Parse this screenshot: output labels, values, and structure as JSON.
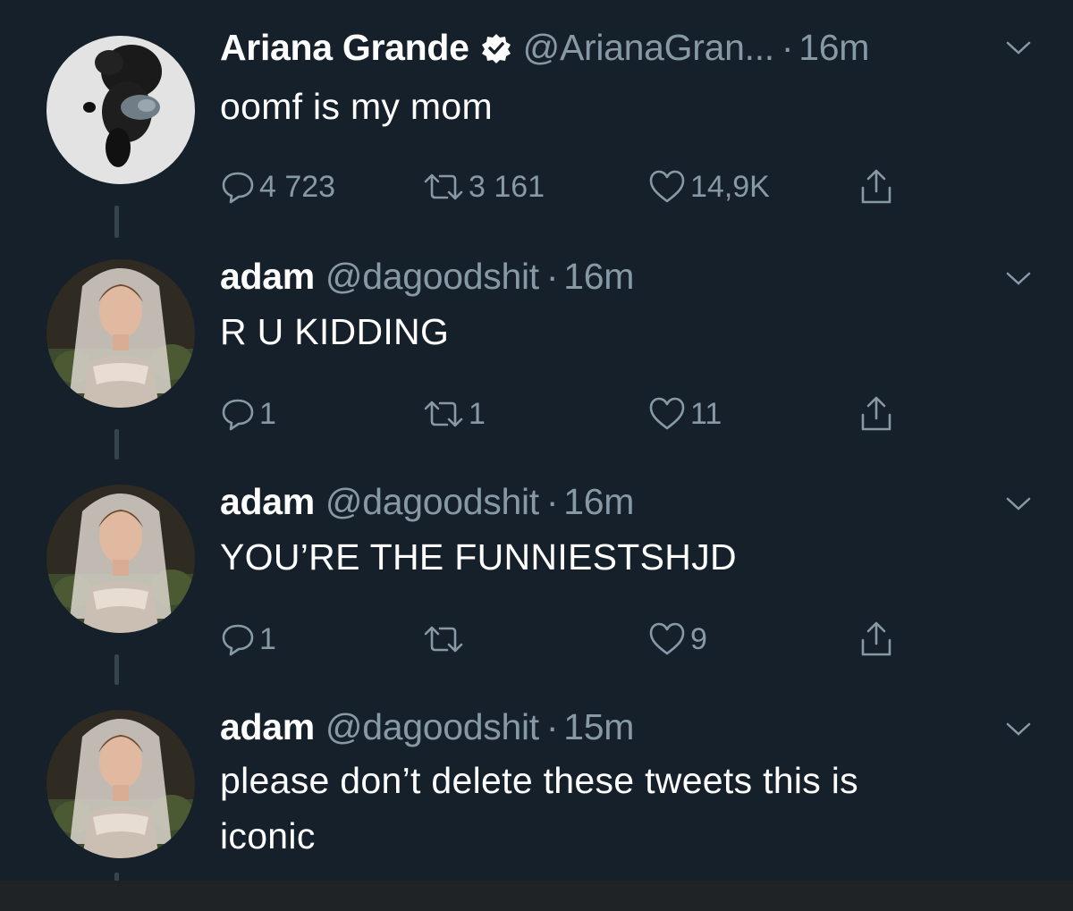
{
  "tweets": [
    {
      "name": "Ariana Grande",
      "verified": true,
      "handle": "@ArianaGran...",
      "separator": "·",
      "time": "16m",
      "text": "oomf is my mom",
      "replies": "4 723",
      "retweets": "3 161",
      "likes": "14,9K",
      "avatar": "black-and-white-kitten-photo"
    },
    {
      "name": "adam",
      "verified": false,
      "handle": "@dagoodshit",
      "separator": "·",
      "time": "16m",
      "text": "R U KIDDING",
      "replies": "1",
      "retweets": "1",
      "likes": "11",
      "avatar": "woman-in-veil-photo"
    },
    {
      "name": "adam",
      "verified": false,
      "handle": "@dagoodshit",
      "separator": "·",
      "time": "16m",
      "text": "YOU’RE THE FUNNIESTSHJD",
      "replies": "1",
      "retweets": "",
      "likes": "9",
      "avatar": "woman-in-veil-photo"
    },
    {
      "name": "adam",
      "verified": false,
      "handle": "@dagoodshit",
      "separator": "·",
      "time": "15m",
      "text_lines": [
        "please don’t delete these tweets this is",
        "iconic"
      ],
      "avatar": "woman-in-veil-photo"
    }
  ],
  "icons": {
    "reply": "speech-bubble-icon",
    "retweet": "retweet-arrows-icon",
    "like": "heart-icon",
    "share": "share-upload-icon",
    "more": "chevron-down-icon",
    "verified": "verified-badge-icon"
  },
  "colors": {
    "background": "#15202b",
    "text": "#ffffff",
    "secondary": "#8899a6",
    "thread_line": "#38444d"
  }
}
